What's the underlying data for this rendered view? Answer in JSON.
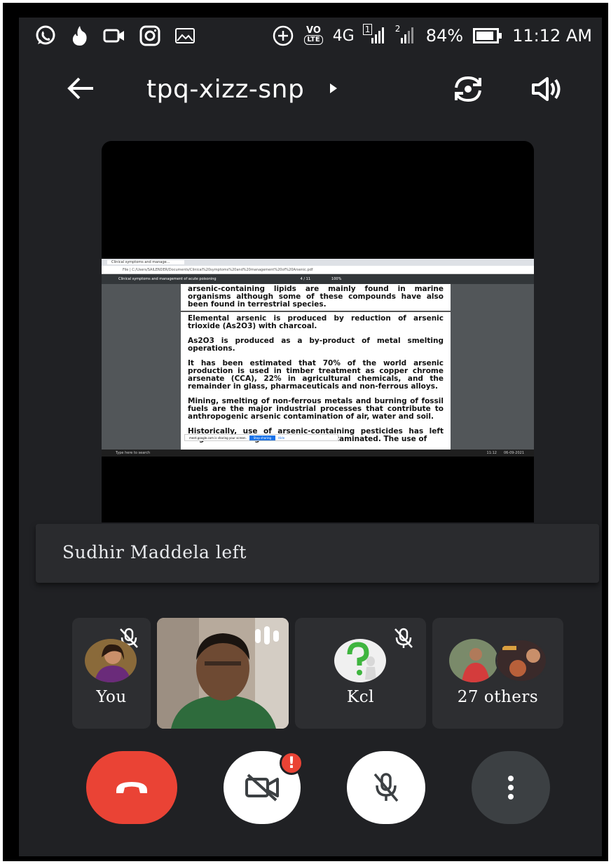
{
  "status_bar": {
    "battery": "84%",
    "time": "11:12 AM",
    "network": "4G",
    "vo_label": "VO",
    "lte_label": "LTE",
    "sim1": "1",
    "sim2": "2"
  },
  "top_bar": {
    "meeting_code": "tpq-xizz-snp"
  },
  "shared_screen": {
    "tab_title": "Clinical symptoms and manage...",
    "address": "File | C:/Users/SAILENDER/Documents/Clinical%20symptoms%20and%20management%20of%20Arsenic.pdf",
    "pdf_title": "Clinical symptoms and management of acute poisoning",
    "page_indicator": "4 / 11",
    "zoom": "100%",
    "paragraphs": [
      "arsenic-containing lipids are mainly found in marine organisms although some of these compounds have also been found in terrestrial species.",
      "Elemental arsenic is produced by reduction of arsenic trioxide (As2O3) with charcoal.",
      "As2O3 is produced as a by-product of metal smelting operations.",
      "It has been estimated that 70% of the world arsenic production is used in timber treatment as copper chrome arsenate (CCA), 22% in agricultural chemicals, and the remainder in glass, pharmaceuticals and non-ferrous alloys.",
      "Mining, smelting of non-ferrous metals and burning of fossil fuels are the major industrial processes that contribute to anthropogenic arsenic contamination of air, water and soil.",
      "Historically, use of arsenic-containing pesticides has left large tracts of agricultural land contaminated. The use of"
    ],
    "share_notice": "meet.google.com is sharing your screen.",
    "stop_sharing": "Stop sharing",
    "hide": "Hide",
    "search_placeholder": "Type here to search",
    "taskbar_time": "11:12",
    "taskbar_date": "06-09-2021"
  },
  "notification": {
    "text": "Sudhir Maddela left"
  },
  "participants": [
    {
      "label": "You"
    },
    {
      "label": ""
    },
    {
      "label": "Kcl"
    },
    {
      "label": "27 others"
    }
  ],
  "controls": {
    "video_alert": "!"
  },
  "colors": {
    "background": "#202124",
    "end_call": "#ea4335",
    "control_light": "#ffffff",
    "control_dark": "#3c4043",
    "alert": "#ea4335"
  }
}
